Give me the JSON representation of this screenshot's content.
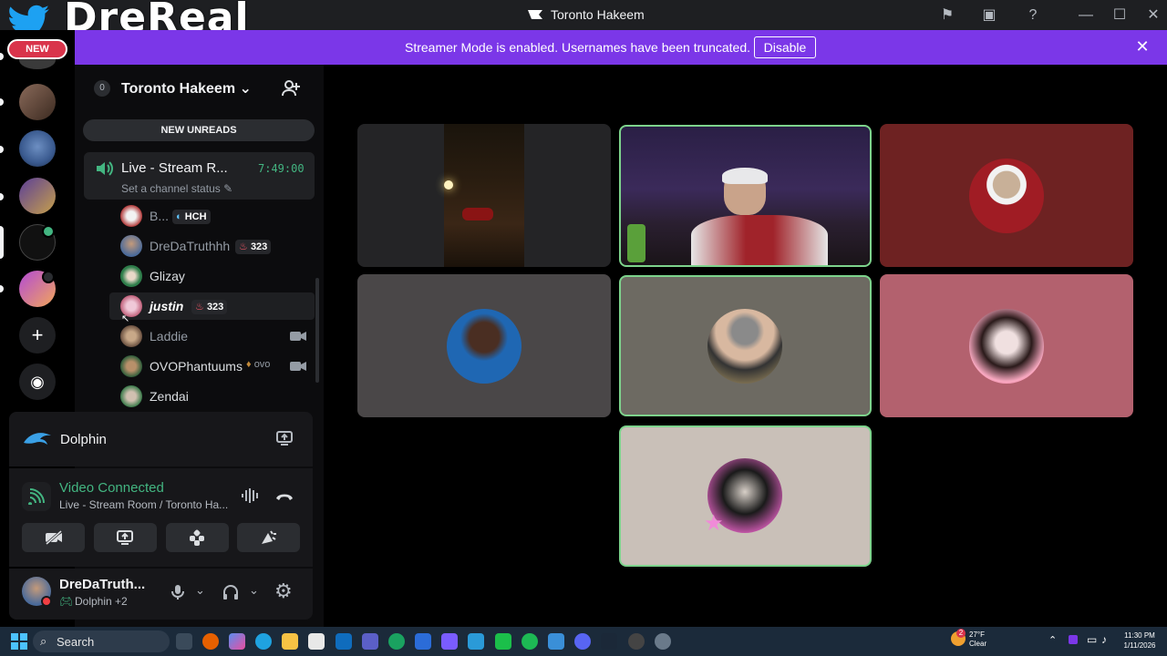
{
  "brand": {
    "logo_text": "DreReal",
    "new_badge": "NEW"
  },
  "window": {
    "title": "Toronto Hakeem"
  },
  "banner": {
    "message": "Streamer Mode is enabled. Usernames have been truncated.",
    "disable_label": "Disable"
  },
  "server": {
    "name": "Toronto Hakeem",
    "count": "0",
    "new_unreads": "NEW UNREADS"
  },
  "voice_channel": {
    "name": "Live - Stream R...",
    "timer": "7:49:00",
    "status_placeholder": "Set a channel status"
  },
  "members": [
    {
      "name": "B...",
      "badge": "HCH"
    },
    {
      "name": "DreDaTruthhh",
      "badge": "323"
    },
    {
      "name": "Glizay",
      "badge": ""
    },
    {
      "name": "justin",
      "badge": "323"
    },
    {
      "name": "Laddie",
      "badge": ""
    },
    {
      "name": "OVOPhantuums",
      "badge": "ovo"
    },
    {
      "name": "Zendai",
      "badge": ""
    }
  ],
  "activity": {
    "name": "Dolphin"
  },
  "voice_status": {
    "title": "Video Connected",
    "subtitle": "Live - Stream Room / Toronto Ha..."
  },
  "user": {
    "name": "DreDaTruth...",
    "activity": "Dolphin +2"
  },
  "taskbar": {
    "search_label": "Search",
    "weather_temp": "27°F",
    "weather_desc": "Clear",
    "time": "11:30 PM",
    "date": "1/11/2026",
    "weather_badge": "2"
  },
  "colors": {
    "accent": "#7b37e8",
    "connected": "#43b581",
    "speaking": "#7dd38c"
  }
}
